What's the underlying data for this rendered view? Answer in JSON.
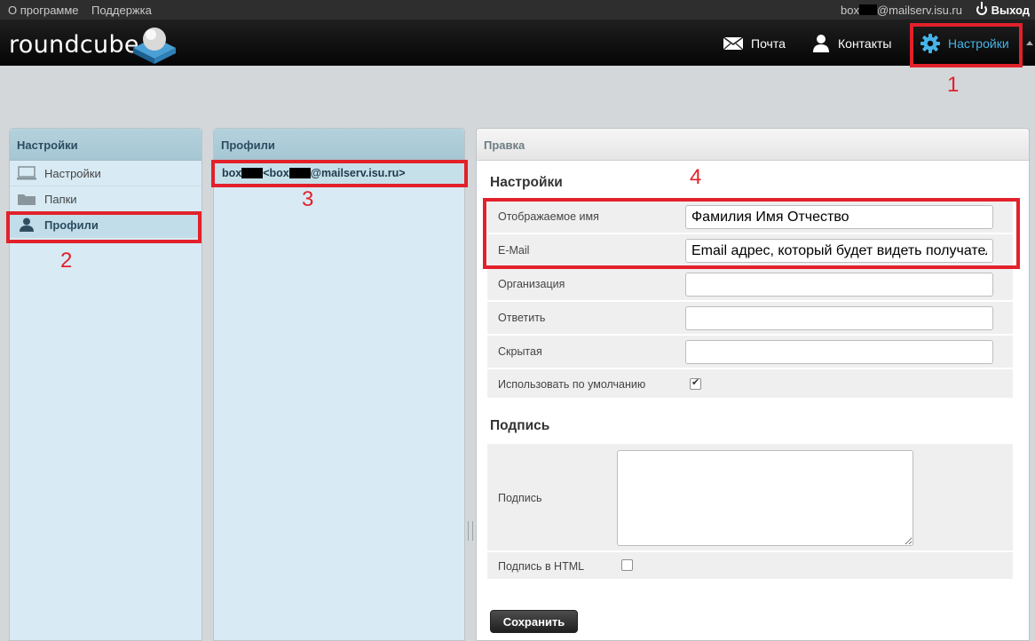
{
  "topbar": {
    "about": "О программе",
    "support": "Поддержка",
    "user_prefix": "box",
    "user_suffix": "@mailserv.isu.ru",
    "logout": "Выход"
  },
  "header": {
    "logo": "roundcube",
    "nav": [
      {
        "label": "Почта",
        "icon": "envelope-icon"
      },
      {
        "label": "Контакты",
        "icon": "person-icon"
      },
      {
        "label": "Настройки",
        "icon": "gear-icon",
        "active": true
      }
    ]
  },
  "colors": {
    "accent": "#45b4e8",
    "annotation": "#e2212b",
    "panel": "#d8ebf4"
  },
  "annotations": [
    "1",
    "2",
    "3",
    "4"
  ],
  "sidebar": {
    "title": "Настройки",
    "items": [
      {
        "label": "Настройки",
        "icon": "monitor-icon"
      },
      {
        "label": "Папки",
        "icon": "folder-icon"
      },
      {
        "label": "Профили",
        "icon": "person-icon",
        "selected": true
      }
    ]
  },
  "profiles": {
    "title": "Профили",
    "identity": {
      "prefix": "box",
      "middle": " <box",
      "suffix": "@mailserv.isu.ru>"
    }
  },
  "edit": {
    "title": "Правка",
    "section_settings": "Настройки",
    "fields": [
      {
        "label": "Отображаемое имя",
        "value": "Фамилия Имя Отчество"
      },
      {
        "label": "E-Mail",
        "value": "Email адрес, который будет видеть получатель"
      },
      {
        "label": "Организация",
        "value": ""
      },
      {
        "label": "Ответить",
        "value": ""
      },
      {
        "label": "Скрытая",
        "value": ""
      }
    ],
    "default_label": "Использовать по умолчанию",
    "default_checked": true,
    "section_signature": "Подпись",
    "signature_label": "Подпись",
    "signature_html_label": "Подпись в HTML",
    "signature_html_checked": false,
    "save": "Сохранить"
  }
}
